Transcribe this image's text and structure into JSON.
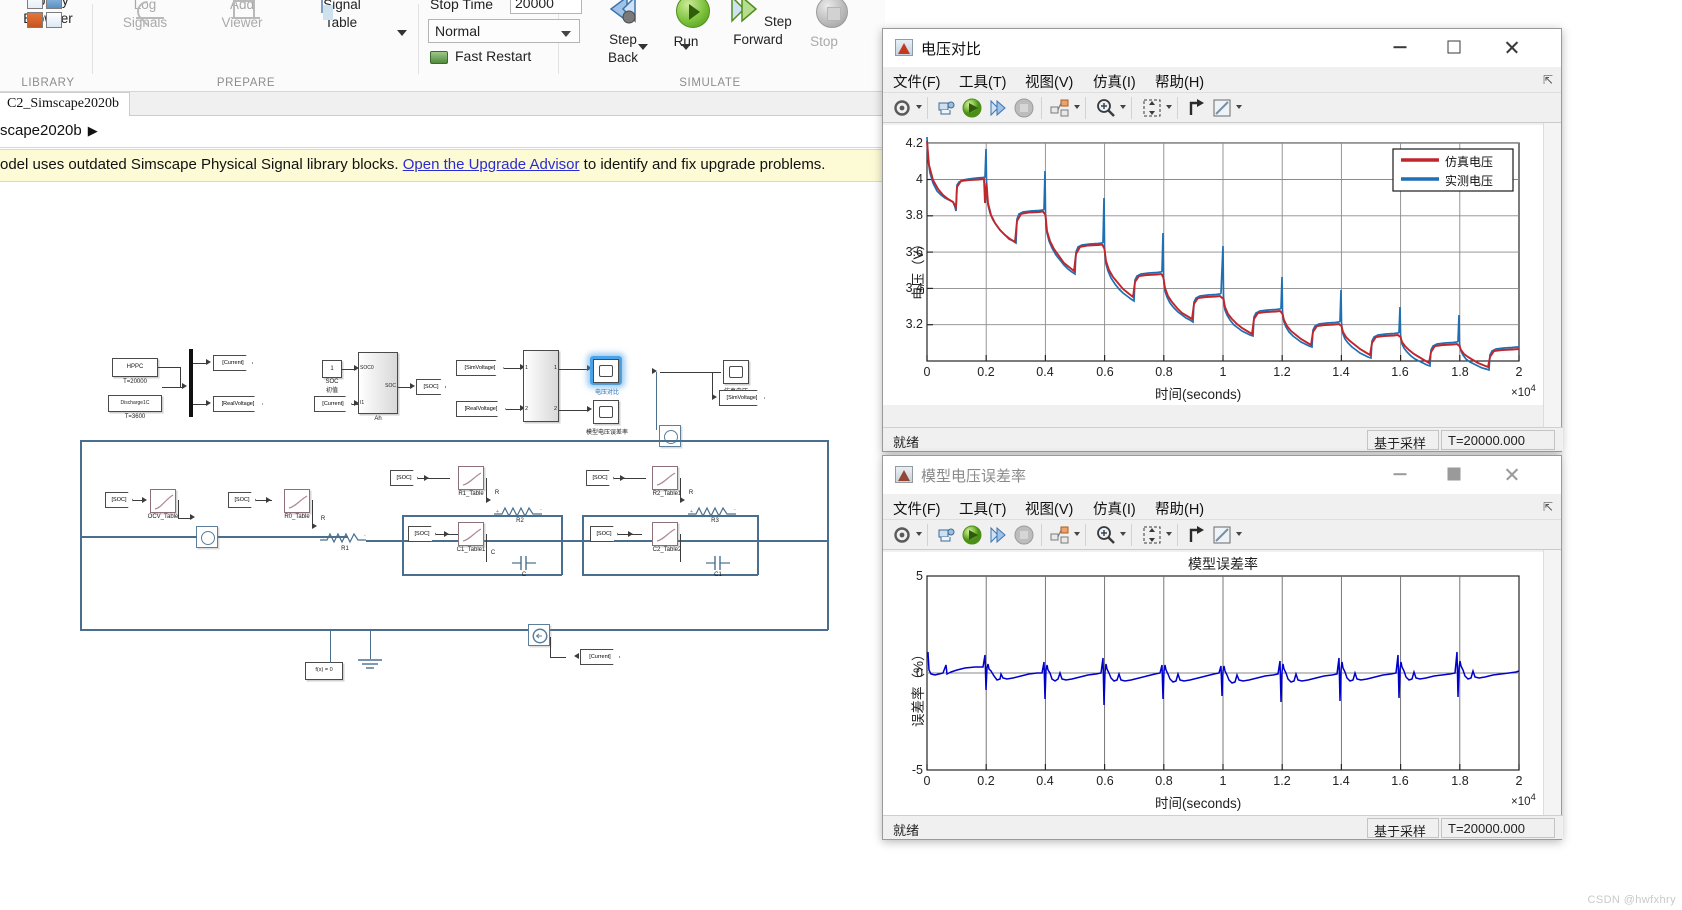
{
  "simulink": {
    "ribbon": {
      "library_group": "LIBRARY",
      "prepare_group": "PREPARE",
      "simulate_group": "SIMULATE",
      "library_browser": [
        "Library",
        "Browser"
      ],
      "log_signals": [
        "Log",
        "Signals"
      ],
      "add_viewer": [
        "Add",
        "Viewer"
      ],
      "signal_table": [
        "Signal",
        "Table"
      ],
      "stop_time_label": "Stop Time",
      "stop_time_value": "20000",
      "mode_value": "Normal",
      "fast_restart": "Fast Restart",
      "step_back": [
        "Step",
        "Back"
      ],
      "run": "Run",
      "step_forward": [
        "Step",
        "Forward"
      ],
      "stop": "Stop"
    },
    "tab_label": "C2_Simscape2020b",
    "breadcrumb": "scape2020b",
    "warning": {
      "text_before": "odel uses outdated Simscape Physical Signal library blocks. ",
      "link": "Open the Upgrade Advisor",
      "text_after": " to identify and fix upgrade problems."
    },
    "diagram": {
      "blocks": [
        {
          "name": "HPPC",
          "caption": "T=20000"
        },
        {
          "name": "Discharge1C",
          "caption": "T=3600"
        },
        {
          "name": "SOC0_const",
          "caption_top": "1",
          "caption": "SOC",
          "caption2": "初值"
        },
        {
          "name": "Ah",
          "caption": "Ah",
          "in1": "SOC0",
          "in2": "I1",
          "out1": "SOC"
        },
        {
          "name": "OCV_Table",
          "caption": "OCV_Table"
        },
        {
          "name": "R0_Table",
          "caption": "R0_Table"
        },
        {
          "name": "R1_Table",
          "caption": "R1_Table"
        },
        {
          "name": "R2_Table1",
          "caption": "R2_Table1"
        },
        {
          "name": "C1_Table1",
          "caption": "C1_Table1"
        },
        {
          "name": "C2_Table2",
          "caption": "C2_Table2"
        },
        {
          "name": "R1",
          "caption": "R1"
        },
        {
          "name": "R2",
          "caption": "R2"
        },
        {
          "name": "R3",
          "caption": "R3"
        },
        {
          "name": "C",
          "caption": "C"
        },
        {
          "name": "C1",
          "caption": "C1"
        },
        {
          "name": "fx",
          "caption": "f(x) = 0"
        }
      ],
      "gotos": [
        "[Current]",
        "[RealVoltage]",
        "[SOC]",
        "[SimVoltage]",
        "[RealVoltage]",
        "[Current]",
        "[SimVoltage]"
      ],
      "scope_labels": [
        "电压对比",
        "模型电压误差率",
        "仿真电压"
      ],
      "mux_ports": [
        "1",
        "2"
      ],
      "r_port": "R",
      "c_port": "C"
    }
  },
  "scope1": {
    "title": "电压对比",
    "menu": [
      "文件(F)",
      "工具(T)",
      "视图(V)",
      "仿真(I)",
      "帮助(H)"
    ],
    "toolbar_icons": [
      "config-gear-icon",
      "print-icon",
      "run-icon",
      "step-forward-icon",
      "stop-icon",
      "layout-icon",
      "zoom-in-icon",
      "autoscale-icon",
      "cursor-measure-icon",
      "style-icon"
    ],
    "status": "就绪",
    "sample_mode": "基于采样",
    "time_readout": "T=20000.000",
    "chart_data": {
      "type": "line",
      "title": "",
      "xlabel": "时间(seconds)",
      "ylabel": "电压（V）",
      "x_exponent": "×10",
      "x_exponent_sup": "4",
      "xlim": [
        0,
        2
      ],
      "ylim": [
        3.1,
        4.3
      ],
      "xticks": [
        "0",
        "0.2",
        "0.4",
        "0.6",
        "0.8",
        "1",
        "1.2",
        "1.4",
        "1.6",
        "1.8",
        "2"
      ],
      "yticks": [
        "3.2",
        "3.4",
        "3.6",
        "3.8",
        "4",
        "4.2"
      ],
      "grid": true,
      "legend_position": "top-right",
      "series": [
        {
          "name": "仿真电压",
          "color": "#c0272d"
        },
        {
          "name": "实测电压",
          "color": "#1f6fb4"
        }
      ],
      "description": "HPPC discharge staircase: voltage decays from 4.25 V to ~3.45 V over 20000 s in 10 pulse-rest steps with relaxation spikes."
    }
  },
  "scope2": {
    "title": "模型电压误差率",
    "menu": [
      "文件(F)",
      "工具(T)",
      "视图(V)",
      "仿真(I)",
      "帮助(H)"
    ],
    "status": "就绪",
    "sample_mode": "基于采样",
    "time_readout": "T=20000.000",
    "chart_data": {
      "type": "line",
      "title": "模型误差率",
      "xlabel": "时间(seconds)",
      "ylabel": "误差率（%）",
      "x_exponent": "×10",
      "x_exponent_sup": "4",
      "xlim": [
        0,
        2
      ],
      "ylim": [
        -5,
        5
      ],
      "xticks": [
        "0",
        "0.2",
        "0.4",
        "0.6",
        "0.8",
        "1",
        "1.2",
        "1.4",
        "1.6",
        "1.8",
        "2"
      ],
      "yticks": [
        "-5",
        "0",
        "5"
      ],
      "grid": true,
      "series": [
        {
          "name": "误差率",
          "color": "#0000cc"
        }
      ],
      "description": "Model error rate oscillating about 0% within ±2%, with transient spikes at each HPPC pulse edge."
    }
  },
  "watermark": "CSDN @hwfxhry"
}
